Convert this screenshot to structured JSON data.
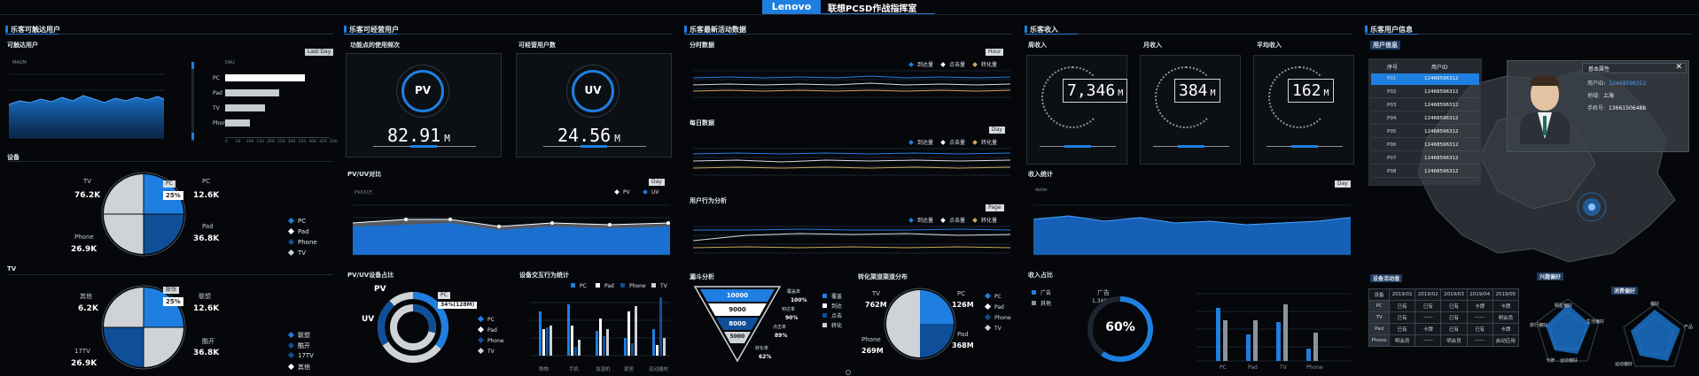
{
  "header": {
    "brand": "Lenovo",
    "title": "联想PCSD作战指挥室"
  },
  "colors": {
    "accent": "#1e7fe0",
    "dark_blue": "#0d4f9c",
    "grey": "#c8ccd1",
    "bg": "#05070a"
  },
  "sections": {
    "reachable": "乐客可触达用户",
    "operable": "乐客可经营用户",
    "activity": "乐客最新活动数据",
    "revenue": "乐客收入",
    "userinfo": "乐客用户信息"
  },
  "reachable": {
    "sub1": "可触达用户",
    "last_day": "Last Day",
    "axis_ylabel": "MAUM",
    "bar_ylabel": "DAU",
    "bars": [
      {
        "name": "PC",
        "value": 380
      },
      {
        "name": "Pad",
        "value": 260
      },
      {
        "name": "TV",
        "value": 190
      },
      {
        "name": "Phone",
        "value": 120
      }
    ],
    "bar_ticks": [
      "0",
      "50",
      "100",
      "150",
      "200",
      "250",
      "300",
      "350",
      "400",
      "450",
      "500"
    ],
    "device_title": "设备",
    "device_pie": {
      "tv_label": "TV",
      "tv_value": "76.2K",
      "pc_label": "PC",
      "pc_value": "12.6K",
      "pad_label": "Pad",
      "pad_value": "36.8K",
      "phone_label": "Phone",
      "phone_value": "26.9K",
      "tag_name": "PC",
      "tag_pct": "25%"
    },
    "device_legend": [
      "PC",
      "Pad",
      "Phone",
      "TV"
    ],
    "tv_title": "TV",
    "tv_pie": {
      "l1": "其他",
      "v1": "6.2K",
      "l2": "联想",
      "v2": "12.6K",
      "l3": "17TV",
      "v3": "26.9K",
      "l4": "酷开",
      "v4": "36.8K",
      "tag_name": "联想",
      "tag_pct": "25%"
    },
    "tv_legend": [
      "联想",
      "酷开",
      "17TV",
      "其他"
    ]
  },
  "operable": {
    "sub1": "功能点的使用频次",
    "sub2": "可经营用户数",
    "pv_label": "PV",
    "pv_value": "82.91",
    "pv_unit": "M",
    "uv_label": "UV",
    "uv_value": "24.56",
    "uv_unit": "M",
    "pvuv_title": "PV/UV对比",
    "pvuv_legend": [
      "PV",
      "UV"
    ],
    "pvuv_unit": "PV/UV万",
    "day": "Day",
    "device_title": "PV/UV设备占比",
    "donut_pv": "PV",
    "donut_uv": "UV",
    "donut_tag_name": "PC",
    "donut_tag_pct": "34%(128M)",
    "donut_legend": [
      "PC",
      "Pad",
      "Phone",
      "TV"
    ],
    "interact_title": "设备交互行为统计",
    "interact_legend": [
      "PC",
      "Pad",
      "Phone",
      "TV"
    ],
    "interact_cats": [
      "购物",
      "手机",
      "加湿机",
      "家居",
      "运动器材"
    ]
  },
  "activity": {
    "sub1": "分时数据",
    "sub1_btn": "Hour",
    "sub2": "每日数据",
    "sub2_btn": "Day",
    "sub3": "用户行为分析",
    "sub3_btn": "Page",
    "line_legend": [
      "到达量",
      "点击量",
      "转化量"
    ],
    "funnel_title": "漏斗分析",
    "funnel_values": [
      "10000",
      "9000",
      "8000",
      "5000"
    ],
    "funnel_labels": [
      {
        "k": "覆盖率",
        "v": "100%"
      },
      {
        "k": "到达率",
        "v": "90%"
      },
      {
        "k": "点击率",
        "v": "89%"
      },
      {
        "k": "转化率",
        "v": "62%"
      }
    ],
    "funnel_legend": [
      "覆盖",
      "到达",
      "点击",
      "转化"
    ],
    "channel_title": "转化渠道渠道分布",
    "ch_tv": "TV",
    "ch_tv_v": "762M",
    "ch_pc": "PC",
    "ch_pc_v": "126M",
    "ch_phone": "Phone",
    "ch_phone_v": "269M",
    "ch_pad": "Pad",
    "ch_pad_v": "368M",
    "ch_legend": [
      "PC",
      "Pad",
      "Phone",
      "TV"
    ]
  },
  "revenue": {
    "cards": [
      {
        "label": "周收入",
        "value": "7,346",
        "unit": "M"
      },
      {
        "label": "月收入",
        "value": "384",
        "unit": "M"
      },
      {
        "label": "平均收入",
        "value": "162",
        "unit": "M"
      }
    ],
    "stat_title": "收入统计",
    "stat_btn": "Day",
    "stat_ylabel": "dollar",
    "share_title": "收入占比",
    "share_legend": [
      "广告",
      "其他"
    ],
    "ad_label": "广告",
    "ad_value": "1,346M",
    "ratio": "60%",
    "bar_cats": [
      "PC",
      "Pad",
      "TV",
      "Phone"
    ]
  },
  "userinfo": {
    "sub1": "用户信息",
    "table_head": [
      "序号",
      "用户ID"
    ],
    "rows": [
      {
        "n": "P01",
        "id": "12468596312"
      },
      {
        "n": "P02",
        "id": "12468596312"
      },
      {
        "n": "P03",
        "id": "12468596312"
      },
      {
        "n": "P04",
        "id": "12468596312"
      },
      {
        "n": "P05",
        "id": "12468596312"
      },
      {
        "n": "P06",
        "id": "12468596312"
      },
      {
        "n": "P07",
        "id": "12468596312"
      },
      {
        "n": "P08",
        "id": "12468596312"
      }
    ],
    "profile_title": "基本属性",
    "profile": [
      {
        "k": "用户ID:",
        "v": "12468596312"
      },
      {
        "k": "地域:",
        "v": "上海"
      },
      {
        "k": "手机号:",
        "v": "13661506488"
      }
    ],
    "device_table_title": "设备活动值",
    "device_table_head": [
      "设备",
      "2019/01",
      "2019/02",
      "2019/03",
      "2019/04",
      "2019/05"
    ],
    "device_table": [
      [
        "PC",
        "已有",
        "已有",
        "已有",
        "卡牌",
        "卡牌"
      ],
      [
        "TV",
        "已有",
        "——",
        "已有",
        "——",
        "明会员"
      ],
      [
        "Pad",
        "已有",
        "卡牌",
        "已有",
        "已有",
        "卡牌"
      ],
      [
        "Phone",
        "明会员",
        "——",
        "明会员",
        "——",
        "启动应用"
      ]
    ],
    "radar1_title": "兴趣偏好",
    "radar2_title": "消费偏好",
    "radar1_labels": [
      "明星偏好",
      "生活偏好",
      "运动偏好",
      "旅行偏好",
      "卡牌"
    ],
    "radar2_labels": [
      "偏好",
      "产品",
      "运动偏好"
    ]
  }
}
